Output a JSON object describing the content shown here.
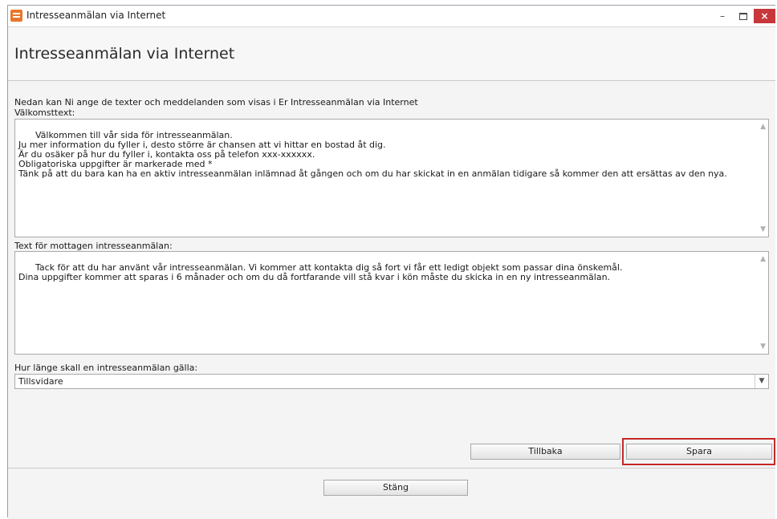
{
  "window": {
    "title": "Intresseanmälan via Internet",
    "controls": {
      "minimize": "–",
      "close": "×"
    }
  },
  "header": {
    "title": "Intresseanmälan via Internet"
  },
  "form": {
    "intro": "Nedan kan Ni ange de texter och meddelanden som visas i Er Intresseanmälan via Internet",
    "welcome_label": "Välkomsttext:",
    "welcome_text": "Välkommen till vår sida för intresseanmälan.\nJu mer information du fyller i, desto större är chansen att vi hittar en bostad åt dig.\nÄr du osäker på hur du fyller i, kontakta oss på telefon xxx-xxxxxx.\nObligatoriska uppgifter är markerade med *\nTänk på att du bara kan ha en aktiv intresseanmälan inlämnad åt gången och om du har skickat in en anmälan tidigare så kommer den att ersättas av den nya.",
    "received_label": "Text för mottagen intresseanmälan:",
    "received_text": "Tack för att du har använt vår intresseanmälan. Vi kommer att kontakta dig så fort vi får ett ledigt objekt som passar dina önskemål.\nDina uppgifter kommer att sparas i 6 månader och om du då fortfarande vill stå kvar i kön måste du skicka in en ny intresseanmälan.",
    "validity_label": "Hur länge skall en intresseanmälan gälla:",
    "validity_value": "Tillsvidare"
  },
  "buttons": {
    "back": "Tillbaka",
    "save": "Spara",
    "close": "Stäng"
  },
  "colors": {
    "highlight": "#c62828",
    "close_button": "#c7383a",
    "app_icon": "#e8762c"
  }
}
